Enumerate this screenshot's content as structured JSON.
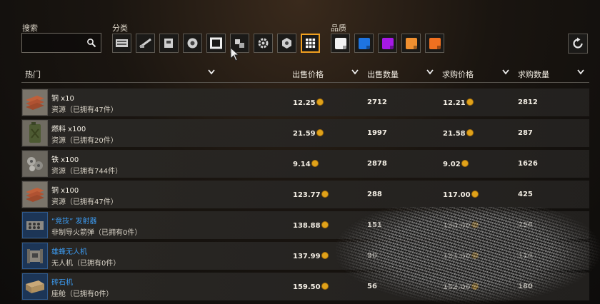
{
  "search": {
    "label": "搜索",
    "value": "",
    "placeholder": ""
  },
  "categories": {
    "label": "分类",
    "items": [
      {
        "icon": "armor-icon"
      },
      {
        "icon": "weapon-icon"
      },
      {
        "icon": "cabin-icon"
      },
      {
        "icon": "wheel-icon"
      },
      {
        "icon": "frame-icon"
      },
      {
        "icon": "parts-icon"
      },
      {
        "icon": "gear-icon"
      },
      {
        "icon": "hex-module-icon"
      },
      {
        "icon": "grid-all-icon",
        "active": true
      }
    ]
  },
  "quality": {
    "label": "品质",
    "swatches": [
      {
        "name": "common",
        "color": "#f2f2f2"
      },
      {
        "name": "rare",
        "color": "#1e74e0"
      },
      {
        "name": "epic",
        "color": "#a619e6"
      },
      {
        "name": "special",
        "color": "#f09030"
      },
      {
        "name": "legendary",
        "color": "#f07020"
      }
    ]
  },
  "header": {
    "popular": "热门",
    "sell_price": "出售价格",
    "sell_qty": "出售数量",
    "buy_price": "求购价格",
    "buy_qty": "求购数量"
  },
  "rows": [
    {
      "name": "铜 x10",
      "sub": "资源（已拥有47件）",
      "sell_price": "12.25",
      "sell_qty": "2712",
      "buy_price": "12.21",
      "buy_qty": "2812",
      "thumb": "copper"
    },
    {
      "name": "燃料 x100",
      "sub": "资源（已拥有20件）",
      "sell_price": "21.59",
      "sell_qty": "1997",
      "buy_price": "21.58",
      "buy_qty": "287",
      "thumb": "fuel"
    },
    {
      "name": "铁 x100",
      "sub": "资源（已拥有744件）",
      "sell_price": "9.14",
      "sell_qty": "2878",
      "buy_price": "9.02",
      "buy_qty": "1626",
      "thumb": "iron"
    },
    {
      "name": "铜 x100",
      "sub": "资源（已拥有47件）",
      "sell_price": "123.77",
      "sell_qty": "288",
      "buy_price": "117.00",
      "buy_qty": "425",
      "thumb": "copper"
    },
    {
      "name": "“竞技” 发射器",
      "sub": "非制导火箭弹（已拥有0件）",
      "sell_price": "138.88",
      "sell_qty": "151",
      "buy_price": "130.00",
      "buy_qty": "256",
      "thumb": "launcher",
      "blue": true
    },
    {
      "name": "雄蜂无人机",
      "sub": "无人机（已拥有0件）",
      "sell_price": "137.99",
      "sell_qty": "90",
      "buy_price": "131.00",
      "buy_qty": "114",
      "thumb": "drone",
      "blue": true
    },
    {
      "name": "砖石机",
      "sub": "座舱（已拥有0件）",
      "sell_price": "159.50",
      "sell_qty": "56",
      "buy_price": "152.00",
      "buy_qty": "180",
      "thumb": "cabin",
      "blue": true
    }
  ]
}
